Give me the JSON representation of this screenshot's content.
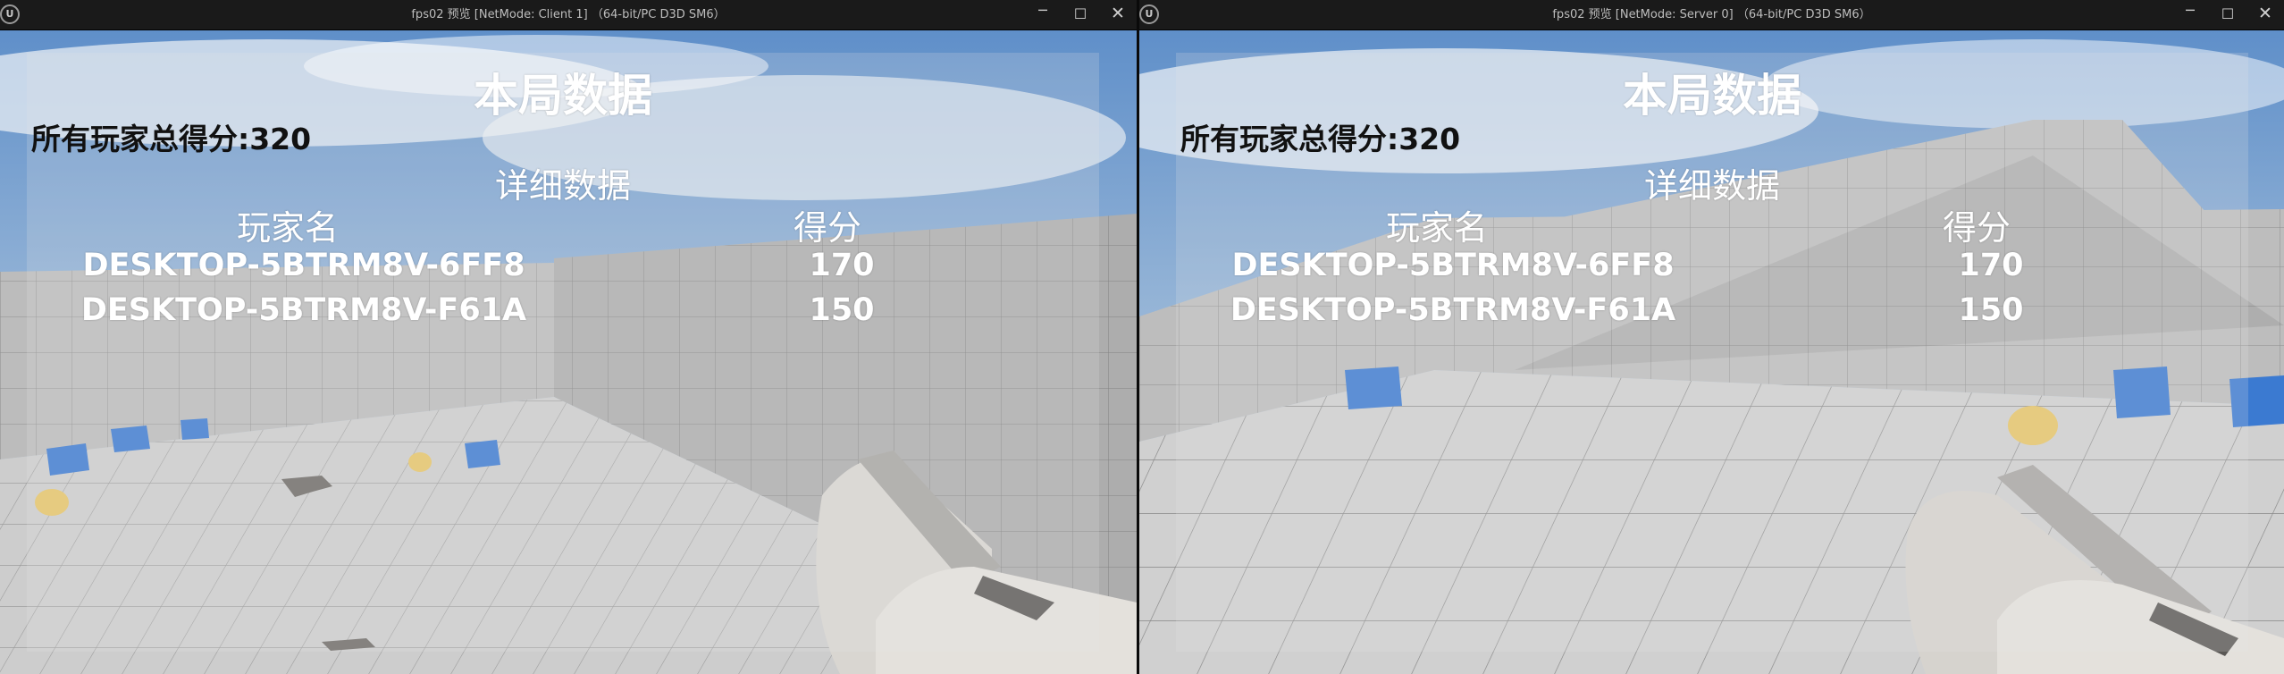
{
  "windows": [
    {
      "id": "client",
      "titlebar": {
        "app_icon": "unreal-engine-logo-icon",
        "title": "fps02 预览 [NetMode: Client 1]  （64-bit/PC D3D SM6）"
      },
      "controls": {
        "minimize": "─",
        "maximize": "☐",
        "close": "✕"
      },
      "hud": {
        "title": "本局数据",
        "total_score_label": "所有玩家总得分:320",
        "details_heading": "详细数据",
        "columns": {
          "player_name": "玩家名",
          "score": "得分"
        },
        "rows": [
          {
            "name": "DESKTOP-5BTRM8V-6FF8",
            "score": "170"
          },
          {
            "name": "DESKTOP-5BTRM8V-F61A",
            "score": "150"
          }
        ]
      }
    },
    {
      "id": "server",
      "titlebar": {
        "app_icon": "unreal-engine-logo-icon",
        "title": "fps02 预览 [NetMode: Server 0]  （64-bit/PC D3D SM6）"
      },
      "controls": {
        "minimize": "─",
        "maximize": "☐",
        "close": "✕"
      },
      "hud": {
        "title": "本局数据",
        "total_score_label": "所有玩家总得分:320",
        "details_heading": "详细数据",
        "columns": {
          "player_name": "玩家名",
          "score": "得分"
        },
        "rows": [
          {
            "name": "DESKTOP-5BTRM8V-6FF8",
            "score": "170"
          },
          {
            "name": "DESKTOP-5BTRM8V-F61A",
            "score": "150"
          }
        ]
      }
    }
  ],
  "colors": {
    "titlebar_bg": "#1a1a1a",
    "hud_text": "#ffffff",
    "hud_total_text": "#111111",
    "cube": "#3a78d0",
    "floor": "#c9c9c9"
  }
}
